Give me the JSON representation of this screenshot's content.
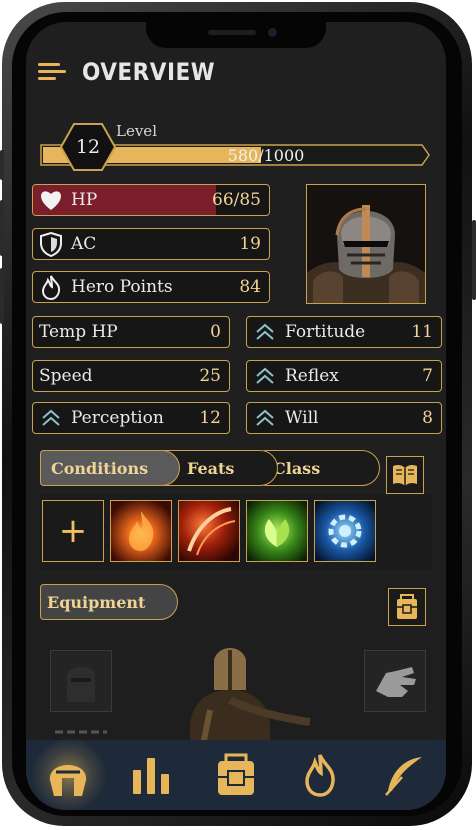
{
  "header": {
    "title": "OVERVIEW",
    "menu_icon": "hamburger-menu-icon"
  },
  "level": {
    "label": "Level",
    "value": "12",
    "xp_text": "580/1000",
    "xp_fraction": 0.58
  },
  "stats_primary": [
    {
      "label": "HP",
      "value": "66/85",
      "icon": "heart-icon",
      "fill_fraction": 0.776
    },
    {
      "label": "AC",
      "value": "19",
      "icon": "shield-icon"
    },
    {
      "label": "Hero Points",
      "value": "84",
      "icon": "flame-icon"
    }
  ],
  "stats_left": [
    {
      "label": "Temp HP",
      "value": "0"
    },
    {
      "label": "Speed",
      "value": "25"
    },
    {
      "label": "Perception",
      "value": "12",
      "icon": "chevron-up-icon"
    }
  ],
  "stats_right": [
    {
      "label": "Fortitude",
      "value": "11",
      "icon": "chevron-up-icon"
    },
    {
      "label": "Reflex",
      "value": "7",
      "icon": "chevron-up-icon"
    },
    {
      "label": "Will",
      "value": "8",
      "icon": "chevron-up-icon"
    }
  ],
  "tabs": [
    {
      "label": "Conditions",
      "active": true
    },
    {
      "label": "Feats",
      "active": false
    },
    {
      "label": "Class",
      "active": false
    }
  ],
  "conditions": {
    "add_label": "+",
    "icons": [
      "fire-spell-icon",
      "blade-slash-icon",
      "leaf-nature-icon",
      "gear-blue-icon"
    ]
  },
  "equipment": {
    "label": "Equipment",
    "icons": [
      "helmet-icon",
      "gauntlet-icon",
      "chain-icon",
      "chest-icon"
    ]
  },
  "nav": [
    "helmet-nav-icon",
    "stats-bars-icon",
    "backpack-icon",
    "flame-nav-icon",
    "feather-icon"
  ],
  "colors": {
    "gold": "#c9a14f",
    "gold_light": "#f0d493",
    "hp_red": "#7a1e2c",
    "background": "#1f1f1f",
    "nav_bg": "#1e2a3a"
  }
}
